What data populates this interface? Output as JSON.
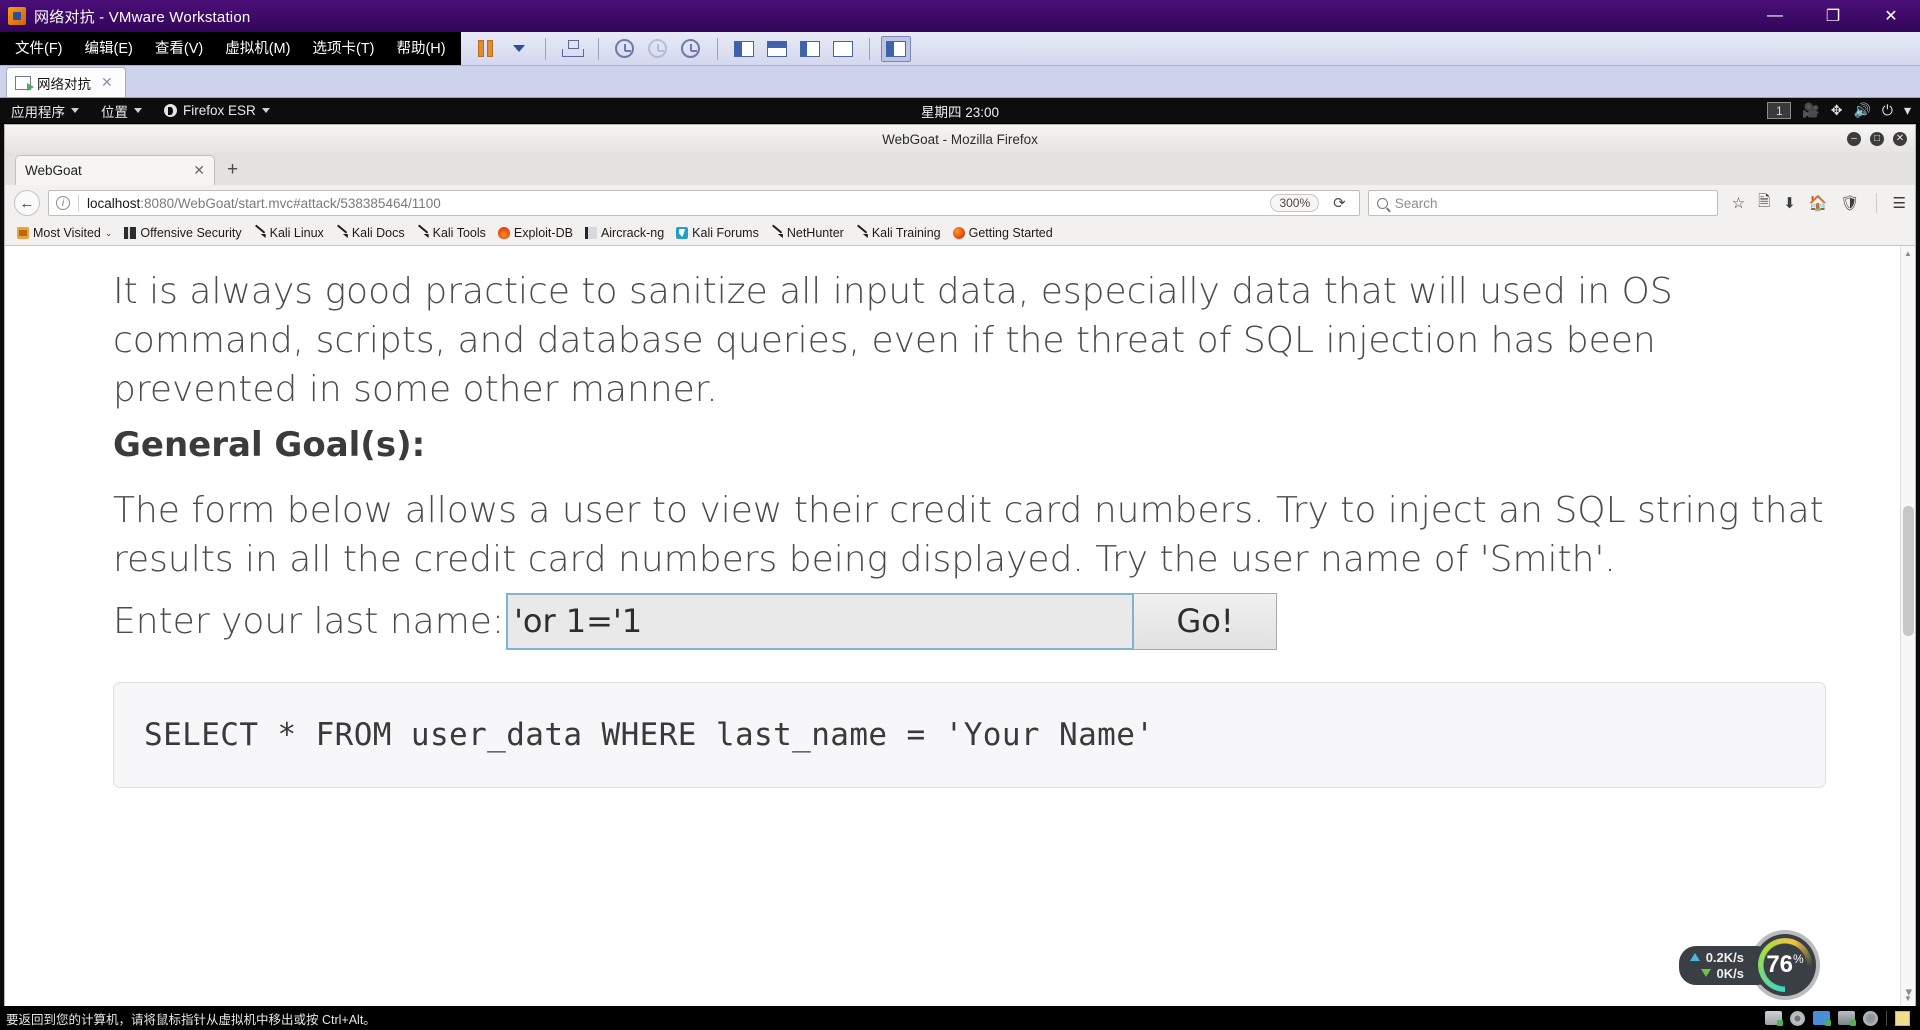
{
  "vmware": {
    "title": "网络对抗 - VMware Workstation",
    "window_controls": {
      "minimize": "—",
      "maximize": "❐",
      "close": "✕"
    },
    "menus": [
      {
        "label": "文件(F)"
      },
      {
        "label": "编辑(E)"
      },
      {
        "label": "查看(V)"
      },
      {
        "label": "虚拟机(M)"
      },
      {
        "label": "选项卡(T)"
      },
      {
        "label": "帮助(H)"
      }
    ],
    "toolbar_icons": [
      "pause-icon",
      "dropdown-caret-icon",
      "snapshot-manager-icon",
      "take-snapshot-icon",
      "revert-snapshot-icon",
      "snapshot-history-icon",
      "show-sidebar-icon",
      "show-thumbnail-bar-icon",
      "unity-mode-icon",
      "full-screen-icon",
      "console-view-icon"
    ],
    "tab": {
      "label": "网络对抗",
      "close": "✕"
    },
    "statusbar": "要返回到您的计算机，请将鼠标指针从虚拟机中移出或按 Ctrl+Alt。",
    "tray_icons": [
      "hard-disk-icon",
      "cd-dvd-icon",
      "network-adapter-icon",
      "printer-icon",
      "usb-controller-icon",
      "notes-icon"
    ]
  },
  "kali_panel": {
    "applications": "应用程序",
    "places": "位置",
    "firefox": "Firefox ESR",
    "clock": "星期四 23:00",
    "workspace": "1",
    "tray_icons": [
      "screen-recorder-icon",
      "bluetooth-icon",
      "volume-icon",
      "power-icon",
      "chevron-down-icon"
    ]
  },
  "firefox": {
    "window_title": "WebGoat - Mozilla Firefox",
    "window_controls": {
      "minimize": "–",
      "maximize": "□",
      "close": "✕"
    },
    "tab": {
      "title": "WebGoat",
      "close": "✕"
    },
    "new_tab": "+",
    "back_icon": "←",
    "url": {
      "host": "localhost",
      "rest": ":8080/WebGoat/start.mvc#attack/538385464/1100"
    },
    "zoom_level": "300%",
    "reload_icon": "⟳",
    "search_placeholder": "Search",
    "nav_icons": [
      "bookmark-star-icon",
      "reader-view-icon",
      "downloads-icon",
      "home-icon",
      "shield-icon",
      "hamburger-menu-icon"
    ],
    "bookmarks": [
      {
        "label": "Most Visited",
        "icon": "folder-icon",
        "caret": "⌄"
      },
      {
        "label": "Offensive Security",
        "icon": "offensive-security-icon"
      },
      {
        "label": "Kali Linux",
        "icon": "kali-dragon-icon"
      },
      {
        "label": "Kali Docs",
        "icon": "kali-dragon-icon"
      },
      {
        "label": "Kali Tools",
        "icon": "kali-dragon-icon"
      },
      {
        "label": "Exploit-DB",
        "icon": "exploit-db-icon"
      },
      {
        "label": "Aircrack-ng",
        "icon": "aircrack-icon"
      },
      {
        "label": "Kali Forums",
        "icon": "kali-forums-icon"
      },
      {
        "label": "NetHunter",
        "icon": "kali-dragon-icon"
      },
      {
        "label": "Kali Training",
        "icon": "kali-dragon-icon"
      },
      {
        "label": "Getting Started",
        "icon": "getting-started-icon"
      }
    ]
  },
  "page": {
    "paragraph1": "It is always good practice to sanitize all input data, especially data that will used in OS command, scripts, and database queries, even if the threat of SQL injection has been prevented in some other manner.",
    "goal_heading": "General Goal(s):",
    "paragraph2": "The form below allows a user to view their credit card numbers. Try to inject an SQL string that results in all the credit card numbers being displayed. Try the user name of 'Smith'.",
    "form": {
      "label": "Enter your last name:",
      "input_value": "'or 1='1",
      "input_placeholder": "",
      "submit_label": "Go!"
    },
    "sql_statement": "SELECT * FROM user_data WHERE last_name = 'Your Name'"
  },
  "net_widget": {
    "upload": "0.2K/s",
    "download": "0K/s",
    "gauge_value": "76",
    "gauge_unit": "%"
  },
  "colors": {
    "vmware_title_bg": "#3b0a63",
    "kali_panel_bg": "#0d0d0d",
    "input_focus_border": "#7fb3d5",
    "accent_orange": "#e08b35"
  }
}
